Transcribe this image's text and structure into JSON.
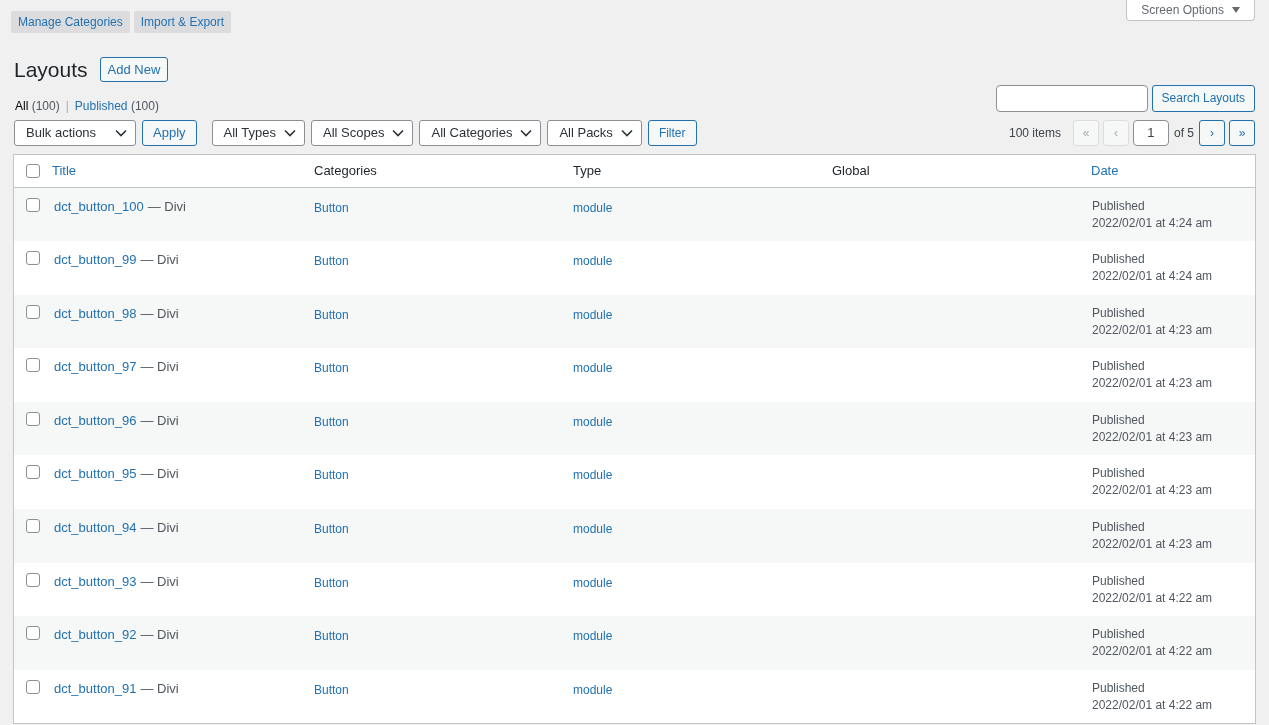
{
  "top_tabs": [
    "Manage Categories",
    "Import & Export"
  ],
  "screen_options": {
    "label": "Screen Options"
  },
  "page_title": "Layouts",
  "add_new": "Add New",
  "views": [
    {
      "label": "All",
      "count": "(100)",
      "selected": true
    },
    {
      "label": "Published",
      "count": "(100)",
      "selected": false
    }
  ],
  "views_separator": "|",
  "search": {
    "button": "Search Layouts"
  },
  "bulk": {
    "select": "Bulk actions",
    "apply": "Apply"
  },
  "filters": [
    "All Types",
    "All Scopes",
    "All Categories",
    "All Packs"
  ],
  "filter_button": "Filter",
  "pagination": {
    "count": "100 items",
    "current": "1",
    "of": "of 5",
    "buttons": [
      {
        "label": "«",
        "disabled": true
      },
      {
        "label": "‹",
        "disabled": true
      },
      {
        "label": "›",
        "disabled": false
      },
      {
        "label": "»",
        "disabled": false
      }
    ]
  },
  "table": {
    "select_all_checked": false,
    "columns": [
      {
        "label": "Title",
        "sortable": true
      },
      {
        "label": "Categories",
        "sortable": false
      },
      {
        "label": "Type",
        "sortable": false
      },
      {
        "label": "Global",
        "sortable": false
      },
      {
        "label": "Date",
        "sortable": true
      }
    ],
    "rows": [
      {
        "checked": false,
        "title": "dct_button_100",
        "suffix": "— Divi",
        "category": "Button",
        "type": "module",
        "status": "Published",
        "date": "2022/02/01 at 4:24 am"
      },
      {
        "checked": false,
        "title": "dct_button_99",
        "suffix": "— Divi",
        "category": "Button",
        "type": "module",
        "status": "Published",
        "date": "2022/02/01 at 4:24 am"
      },
      {
        "checked": false,
        "title": "dct_button_98",
        "suffix": "— Divi",
        "category": "Button",
        "type": "module",
        "status": "Published",
        "date": "2022/02/01 at 4:23 am"
      },
      {
        "checked": false,
        "title": "dct_button_97",
        "suffix": "— Divi",
        "category": "Button",
        "type": "module",
        "status": "Published",
        "date": "2022/02/01 at 4:23 am"
      },
      {
        "checked": false,
        "title": "dct_button_96",
        "suffix": "— Divi",
        "category": "Button",
        "type": "module",
        "status": "Published",
        "date": "2022/02/01 at 4:23 am"
      },
      {
        "checked": false,
        "title": "dct_button_95",
        "suffix": "— Divi",
        "category": "Button",
        "type": "module",
        "status": "Published",
        "date": "2022/02/01 at 4:23 am"
      },
      {
        "checked": false,
        "title": "dct_button_94",
        "suffix": "— Divi",
        "category": "Button",
        "type": "module",
        "status": "Published",
        "date": "2022/02/01 at 4:23 am"
      },
      {
        "checked": false,
        "title": "dct_button_93",
        "suffix": "— Divi",
        "category": "Button",
        "type": "module",
        "status": "Published",
        "date": "2022/02/01 at 4:22 am"
      },
      {
        "checked": false,
        "title": "dct_button_92",
        "suffix": "— Divi",
        "category": "Button",
        "type": "module",
        "status": "Published",
        "date": "2022/02/01 at 4:22 am"
      },
      {
        "checked": false,
        "title": "dct_button_91",
        "suffix": "— Divi",
        "category": "Button",
        "type": "module",
        "status": "Published",
        "date": "2022/02/01 at 4:22 am"
      }
    ]
  }
}
